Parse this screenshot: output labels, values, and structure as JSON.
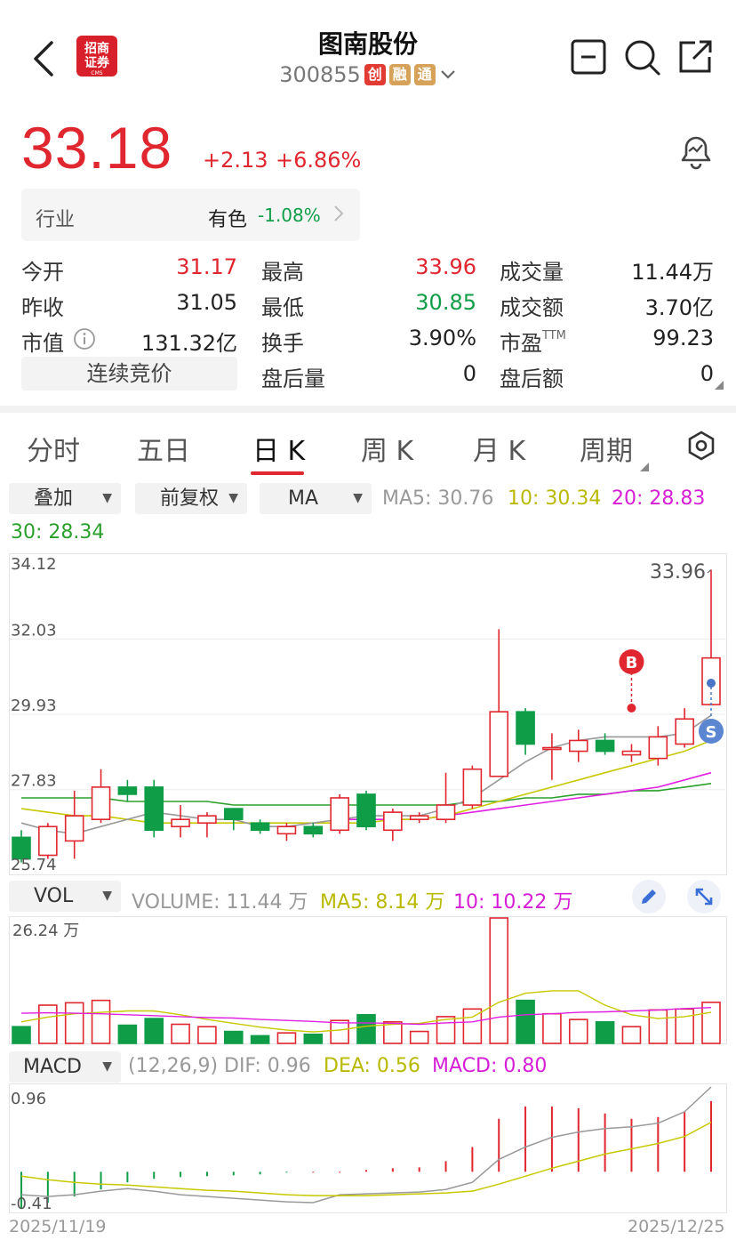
{
  "header": {
    "name": "图南股份",
    "code": "300855",
    "tags": [
      "创",
      "融",
      "通"
    ],
    "logo_text": [
      "招商",
      "证券"
    ],
    "logo_sub": "CMS"
  },
  "quote": {
    "price": "33.18",
    "change": "+2.13",
    "change_pct": "+6.86%",
    "industry_label": "行业",
    "industry_name": "有色",
    "industry_chg": "-1.08%",
    "rows": [
      {
        "l1": "今开",
        "v1": "31.17",
        "l2": "最高",
        "v2": "33.96",
        "l3": "成交量",
        "v3": "11.44万"
      },
      {
        "l1": "昨收",
        "v1": "31.05",
        "l2": "最低",
        "v2": "30.85",
        "l3": "成交额",
        "v3": "3.70亿"
      },
      {
        "l1": "市值",
        "v1": "131.32亿",
        "l2": "换手",
        "v2": "3.90%",
        "l3": "市盈",
        "v3": "99.23"
      },
      {
        "l1": "",
        "v1": "",
        "l2": "盘后量",
        "v2": "0",
        "l3": "盘后额",
        "v3": "0"
      }
    ],
    "pe_sup": "TTM",
    "auction": "连续竞价"
  },
  "tabs": [
    "分时",
    "五日",
    "日 K",
    "周 K",
    "月 K",
    "周期"
  ],
  "toolbar": {
    "overlay": "叠加",
    "adjust": "前复权",
    "indicator": "MA",
    "ma5": "MA5: 30.76",
    "ma10": "10: 30.34",
    "ma20": "20: 28.83",
    "ma30": "30: 28.34"
  },
  "volume_bar": {
    "indicator": "VOL",
    "volume": "VOLUME: 11.44 万",
    "ma5": "MA5: 8.14 万",
    "ma10": "10: 10.22 万",
    "max_label": "26.24 万"
  },
  "macd_bar": {
    "indicator": "MACD",
    "params": "(12,26,9)",
    "dif": "DIF: 0.96",
    "dea": "DEA: 0.56",
    "macd": "MACD: 0.80",
    "max_label": "0.96",
    "min_label": "-0.41"
  },
  "dates": {
    "start": "2025/11/19",
    "end": "2025/12/25"
  },
  "colors": {
    "up": "#e0262e",
    "down": "#0f9d47",
    "ma5": "#999999",
    "ma10": "#c8c800",
    "ma20": "#e020e0",
    "ma30": "#2ca02c"
  },
  "chart_data": {
    "type": "candlestick",
    "y_labels": [
      "34.12",
      "32.03",
      "29.93",
      "27.83",
      "25.74"
    ],
    "ylim": [
      25.74,
      34.12
    ],
    "max_marker": "33.96",
    "buy_marker": "B",
    "sell_marker": "S",
    "candles": [
      {
        "o": 26.5,
        "c": 25.9,
        "h": 26.7,
        "l": 25.8
      },
      {
        "o": 26.0,
        "c": 26.8,
        "h": 26.9,
        "l": 25.9
      },
      {
        "o": 26.4,
        "c": 27.1,
        "h": 27.8,
        "l": 25.9
      },
      {
        "o": 27.0,
        "c": 27.9,
        "h": 28.4,
        "l": 26.9
      },
      {
        "o": 27.9,
        "c": 27.7,
        "h": 28.1,
        "l": 27.5
      },
      {
        "o": 27.9,
        "c": 26.7,
        "h": 28.1,
        "l": 26.5
      },
      {
        "o": 26.8,
        "c": 27.0,
        "h": 27.4,
        "l": 26.5
      },
      {
        "o": 26.9,
        "c": 27.1,
        "h": 27.2,
        "l": 26.5
      },
      {
        "o": 27.3,
        "c": 27.0,
        "h": 27.3,
        "l": 26.7
      },
      {
        "o": 26.9,
        "c": 26.7,
        "h": 27.0,
        "l": 26.6
      },
      {
        "o": 26.6,
        "c": 26.8,
        "h": 26.9,
        "l": 26.4
      },
      {
        "o": 26.8,
        "c": 26.6,
        "h": 26.9,
        "l": 26.5
      },
      {
        "o": 26.7,
        "c": 27.6,
        "h": 27.7,
        "l": 26.6
      },
      {
        "o": 27.7,
        "c": 26.8,
        "h": 27.8,
        "l": 26.7
      },
      {
        "o": 26.7,
        "c": 27.2,
        "h": 27.3,
        "l": 26.4
      },
      {
        "o": 27.0,
        "c": 27.1,
        "h": 27.2,
        "l": 26.9
      },
      {
        "o": 27.0,
        "c": 27.4,
        "h": 28.3,
        "l": 26.9
      },
      {
        "o": 27.4,
        "c": 28.4,
        "h": 28.5,
        "l": 27.3
      },
      {
        "o": 28.2,
        "c": 30.0,
        "h": 32.3,
        "l": 28.2
      },
      {
        "o": 30.0,
        "c": 29.1,
        "h": 30.1,
        "l": 28.8
      },
      {
        "o": 29.0,
        "c": 29.0,
        "h": 29.4,
        "l": 28.1
      },
      {
        "o": 28.9,
        "c": 29.2,
        "h": 29.5,
        "l": 28.6
      },
      {
        "o": 29.2,
        "c": 28.9,
        "h": 29.4,
        "l": 28.8
      },
      {
        "o": 28.8,
        "c": 28.9,
        "h": 29.1,
        "l": 28.6
      },
      {
        "o": 28.7,
        "c": 29.3,
        "h": 29.6,
        "l": 28.5
      },
      {
        "o": 29.1,
        "c": 29.8,
        "h": 30.1,
        "l": 29.0
      },
      {
        "o": 30.2,
        "c": 31.5,
        "h": 33.96,
        "l": 30.2
      }
    ],
    "ma5": [
      26.9,
      26.7,
      26.6,
      26.8,
      27.0,
      27.2,
      27.1,
      27.0,
      27.0,
      26.8,
      26.8,
      26.9,
      27.0,
      27.1,
      27.1,
      27.1,
      27.3,
      27.6,
      28.1,
      28.6,
      29.0,
      29.2,
      29.3,
      29.3,
      29.3,
      29.4,
      29.9
    ],
    "ma10": [
      27.3,
      27.2,
      27.1,
      27.1,
      27.0,
      26.9,
      26.9,
      26.9,
      26.9,
      26.9,
      26.9,
      26.9,
      26.9,
      26.9,
      27.0,
      27.0,
      27.1,
      27.3,
      27.5,
      27.7,
      27.9,
      28.1,
      28.3,
      28.5,
      28.7,
      28.9,
      29.2
    ],
    "ma20": [
      null,
      null,
      null,
      null,
      null,
      null,
      null,
      null,
      null,
      null,
      null,
      null,
      27.0,
      27.0,
      27.0,
      27.0,
      27.1,
      27.2,
      27.3,
      27.4,
      27.5,
      27.6,
      27.7,
      27.8,
      27.9,
      28.1,
      28.3
    ],
    "ma30": [
      27.6,
      27.6,
      27.6,
      27.6,
      27.5,
      27.5,
      27.5,
      27.5,
      27.4,
      27.4,
      27.4,
      27.4,
      27.4,
      27.4,
      27.4,
      27.4,
      27.4,
      27.5,
      27.5,
      27.6,
      27.6,
      27.7,
      27.7,
      27.8,
      27.8,
      27.9,
      28.0
    ],
    "volume": [
      3.5,
      8.0,
      8.5,
      9.0,
      3.8,
      5.2,
      4.0,
      3.5,
      2.5,
      1.6,
      2.2,
      1.9,
      4.8,
      6.0,
      4.5,
      2.5,
      5.6,
      7.2,
      26.24,
      9.0,
      6.2,
      5.0,
      4.5,
      3.5,
      7.0,
      7.2,
      8.6
    ],
    "vol_ma5": [
      4.5,
      5.5,
      6.2,
      6.5,
      6.8,
      6.8,
      6.0,
      5.0,
      4.2,
      3.4,
      2.8,
      2.4,
      2.8,
      3.6,
      4.0,
      4.2,
      5.0,
      5.5,
      8.6,
      10.5,
      11.0,
      11.0,
      8.0,
      6.0,
      5.2,
      5.6,
      6.5
    ],
    "vol_ma10": [
      6.3,
      6.4,
      6.3,
      6.2,
      6.0,
      5.8,
      5.6,
      5.4,
      5.3,
      5.0,
      4.8,
      4.6,
      4.3,
      4.3,
      4.2,
      4.0,
      4.3,
      4.5,
      5.5,
      6.0,
      6.2,
      6.5,
      6.6,
      6.8,
      7.0,
      7.3,
      7.5
    ],
    "macd_hist": [
      -0.41,
      -0.35,
      -0.28,
      -0.2,
      -0.12,
      -0.08,
      -0.06,
      -0.05,
      -0.04,
      -0.03,
      -0.01,
      0.0,
      0.01,
      0.02,
      0.04,
      0.05,
      0.12,
      0.28,
      0.6,
      0.74,
      0.74,
      0.72,
      0.66,
      0.6,
      0.62,
      0.68,
      0.8
    ],
    "dif": [
      -0.26,
      -0.28,
      -0.26,
      -0.22,
      -0.19,
      -0.22,
      -0.26,
      -0.28,
      -0.3,
      -0.32,
      -0.34,
      -0.35,
      -0.26,
      -0.25,
      -0.24,
      -0.23,
      -0.2,
      -0.12,
      0.14,
      0.28,
      0.39,
      0.45,
      0.49,
      0.51,
      0.55,
      0.68,
      0.96
    ],
    "dea": [
      -0.05,
      -0.09,
      -0.12,
      -0.14,
      -0.15,
      -0.17,
      -0.19,
      -0.21,
      -0.22,
      -0.24,
      -0.26,
      -0.27,
      -0.27,
      -0.27,
      -0.26,
      -0.25,
      -0.24,
      -0.22,
      -0.14,
      -0.05,
      0.04,
      0.12,
      0.2,
      0.26,
      0.32,
      0.4,
      0.56
    ]
  }
}
